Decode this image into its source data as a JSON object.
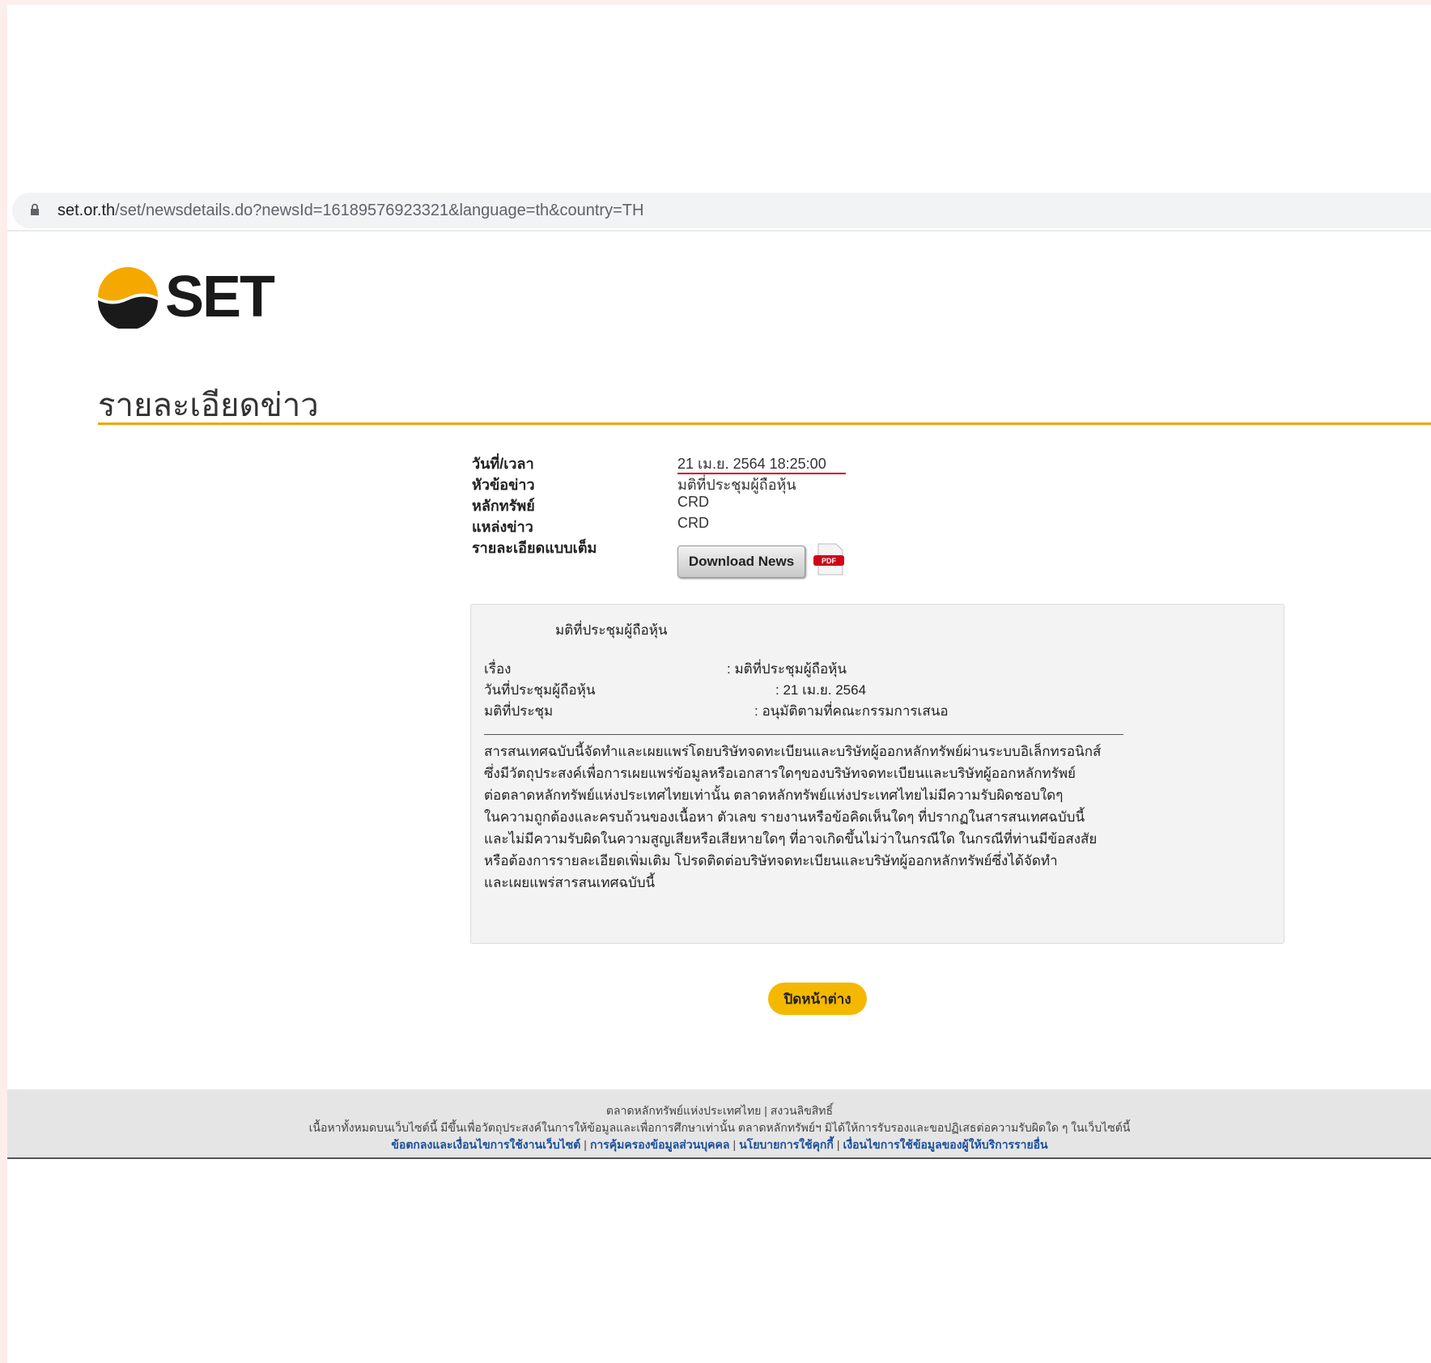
{
  "browser": {
    "url_host": "set.or.th",
    "url_path": "/set/newsdetails.do?newsId=16189576923321&language=th&country=TH"
  },
  "logo": {
    "text": "SET"
  },
  "page": {
    "title": "รายละเอียดข่าว"
  },
  "info": {
    "rows": [
      {
        "label": "วันที่/เวลา",
        "value": "21 เม.ย. 2564 18:25:00"
      },
      {
        "label": "หัวข้อข่าว",
        "value": "มติที่ประชุมผู้ถือหุ้น"
      },
      {
        "label": "หลักทรัพย์",
        "value": "CRD"
      },
      {
        "label": "แหล่งข่าว",
        "value": "CRD"
      },
      {
        "label": "รายละเอียดแบบเต็ม",
        "value": ""
      }
    ],
    "download_label": "Download News",
    "pdf_icon_label": "PDF"
  },
  "content": {
    "heading": "มติที่ประชุมผู้ถือหุ้น",
    "fields": [
      {
        "label": "เรื่อง",
        "value": ": มติที่ประชุมผู้ถือหุ้น"
      },
      {
        "label": "วันที่ประชุมผู้ถือหุ้น",
        "value": ": 21 เม.ย. 2564"
      },
      {
        "label": "มติที่ประชุม",
        "value": ": อนุมัติตามที่คณะกรรมการเสนอ"
      }
    ],
    "disclaimer_lines": [
      "สารสนเทศฉบับนี้จัดทำและเผยแพร่โดยบริษัทจดทะเบียนและบริษัทผู้ออกหลักทรัพย์ผ่านระบบอิเล็กทรอนิกส์",
      "ซึ่งมีวัตถุประสงค์เพื่อการเผยแพร่ข้อมูลหรือเอกสารใดๆของบริษัทจดทะเบียนและบริษัทผู้ออกหลักทรัพย์",
      "ต่อตลาดหลักทรัพย์แห่งประเทศไทยเท่านั้น ตลาดหลักทรัพย์แห่งประเทศไทยไม่มีความรับผิดชอบใดๆ",
      "ในความถูกต้องและครบถ้วนของเนื้อหา ตัวเลข รายงานหรือข้อคิดเห็นใดๆ ที่ปรากฏในสารสนเทศฉบับนี้",
      "และไม่มีความรับผิดในความสูญเสียหรือเสียหายใดๆ ที่อาจเกิดขึ้นไม่ว่าในกรณีใด ในกรณีที่ท่านมีข้อสงสัย",
      "หรือต้องการรายละเอียดเพิ่มเติม โปรดติดต่อบริษัทจดทะเบียนและบริษัทผู้ออกหลักทรัพย์ซึ่งได้จัดทำ",
      "และเผยแพร่สารสนเทศฉบับนี้"
    ]
  },
  "close_button": {
    "label": "ปิดหน้าต่าง"
  },
  "footer": {
    "line1": "ตลาดหลักทรัพย์แห่งประเทศไทย | สงวนลิขสิทธิ์",
    "line2": "เนื้อหาทั้งหมดบนเว็บไซต์นี้ มีขึ้นเพื่อวัตถุประสงค์ในการให้ข้อมูลและเพื่อการศึกษาเท่านั้น ตลาดหลักทรัพย์ฯ มิได้ให้การรับรองและขอปฏิเสธต่อความรับผิดใด ๆ ในเว็บไซต์นี้",
    "links": [
      "ข้อตกลงและเงื่อนไขการใช้งานเว็บไซต์",
      "การคุ้มครองข้อมูลส่วนบุคคล",
      "นโยบายการใช้คุกกี้",
      "เงื่อนไขการใช้ข้อมูลของผู้ให้บริการรายอื่น"
    ]
  }
}
